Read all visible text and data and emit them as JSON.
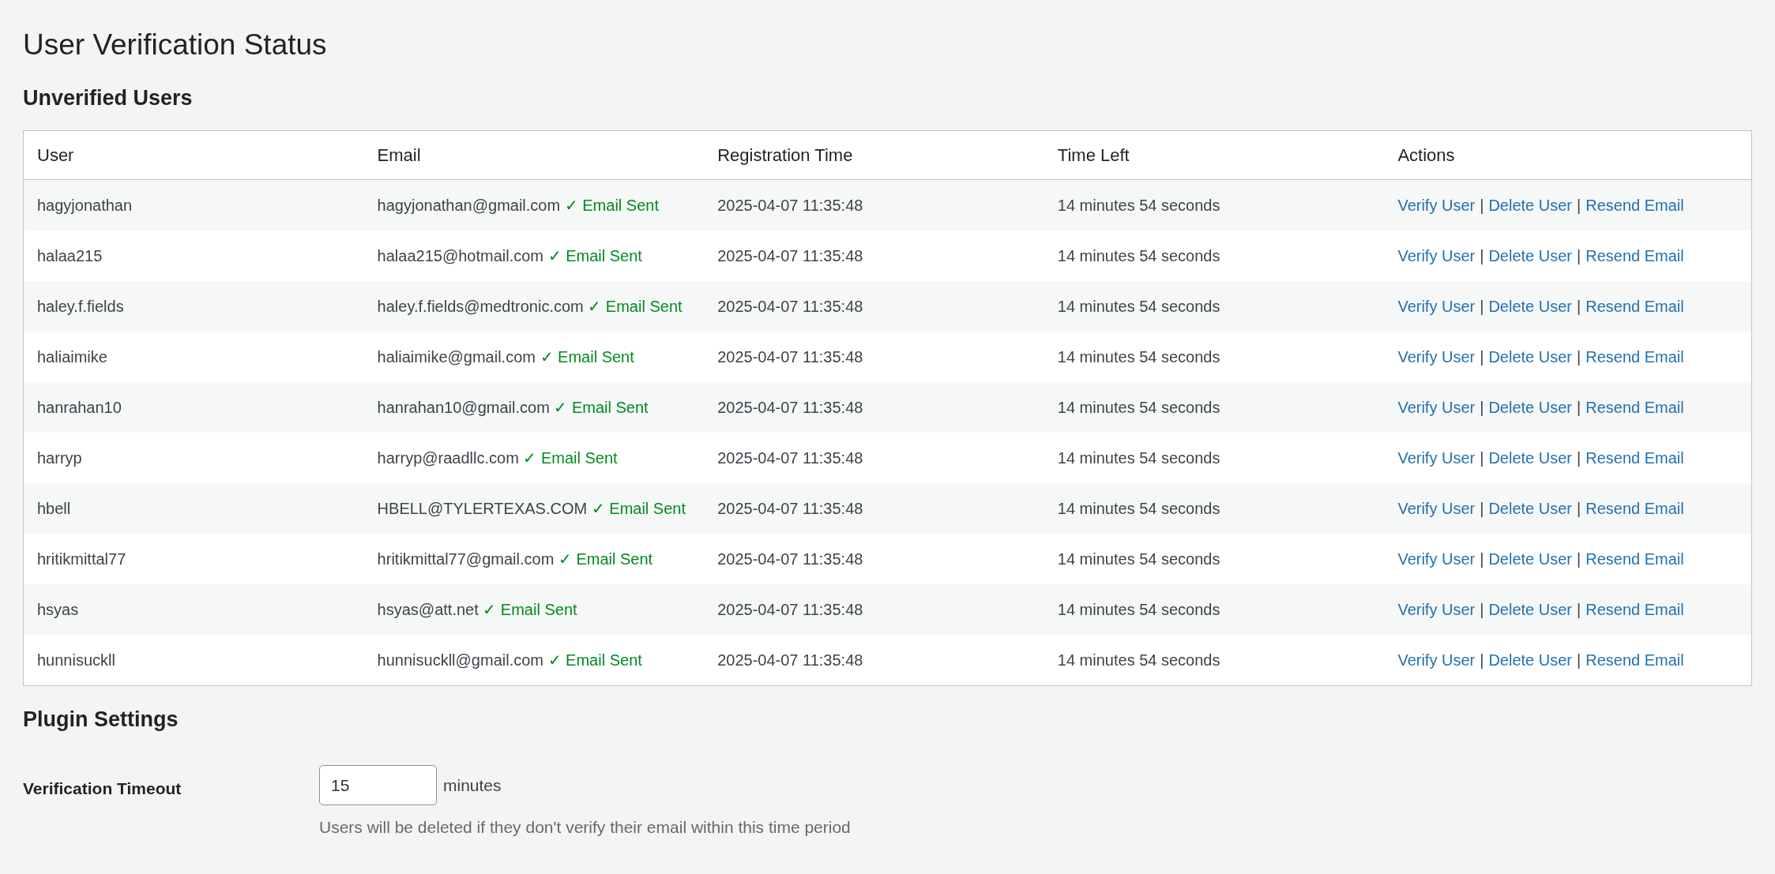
{
  "page_title": "User Verification Status",
  "unverified_section": {
    "heading": "Unverified Users"
  },
  "table": {
    "columns": [
      "User",
      "Email",
      "Registration Time",
      "Time Left",
      "Actions"
    ],
    "rows": [
      {
        "user": "hagyjonathan",
        "email": "hagyjonathan@gmail.com",
        "status": "✓ Email Sent",
        "registration": "2025-04-07 11:35:48",
        "time_left": "14 minutes 54 seconds",
        "actions": [
          {
            "kind": "link",
            "label": "Verify User"
          },
          {
            "kind": "separator",
            "label": "|"
          },
          {
            "kind": "link",
            "label": "Delete User"
          },
          {
            "kind": "separator",
            "label": "|"
          },
          {
            "kind": "link",
            "label": "Resend Email"
          }
        ]
      },
      {
        "user": "halaa215",
        "email": "halaa215@hotmail.com",
        "status": "✓ Email Sent",
        "registration": "2025-04-07 11:35:48",
        "time_left": "14 minutes 54 seconds",
        "actions": [
          {
            "kind": "link",
            "label": "Verify User"
          },
          {
            "kind": "separator",
            "label": "|"
          },
          {
            "kind": "link",
            "label": "Delete User"
          },
          {
            "kind": "separator",
            "label": "|"
          },
          {
            "kind": "link",
            "label": "Resend Email"
          }
        ]
      },
      {
        "user": "haley.f.fields",
        "email": "haley.f.fields@medtronic.com",
        "status": "✓ Email Sent",
        "registration": "2025-04-07 11:35:48",
        "time_left": "14 minutes 54 seconds",
        "actions": [
          {
            "kind": "link",
            "label": "Verify User"
          },
          {
            "kind": "separator",
            "label": "|"
          },
          {
            "kind": "link",
            "label": "Delete User"
          },
          {
            "kind": "separator",
            "label": "|"
          },
          {
            "kind": "link",
            "label": "Resend Email"
          }
        ]
      },
      {
        "user": "haliaimike",
        "email": "haliaimike@gmail.com",
        "status": "✓ Email Sent",
        "registration": "2025-04-07 11:35:48",
        "time_left": "14 minutes 54 seconds",
        "actions": [
          {
            "kind": "link",
            "label": "Verify User"
          },
          {
            "kind": "separator",
            "label": "|"
          },
          {
            "kind": "link",
            "label": "Delete User"
          },
          {
            "kind": "separator",
            "label": "|"
          },
          {
            "kind": "link",
            "label": "Resend Email"
          }
        ]
      },
      {
        "user": "hanrahan10",
        "email": "hanrahan10@gmail.com",
        "status": "✓ Email Sent",
        "registration": "2025-04-07 11:35:48",
        "time_left": "14 minutes 54 seconds",
        "actions": [
          {
            "kind": "link",
            "label": "Verify User"
          },
          {
            "kind": "separator",
            "label": "|"
          },
          {
            "kind": "link",
            "label": "Delete User"
          },
          {
            "kind": "separator",
            "label": "|"
          },
          {
            "kind": "link",
            "label": "Resend Email"
          }
        ]
      },
      {
        "user": "harryp",
        "email": "harryp@raadllc.com",
        "status": "✓ Email Sent",
        "registration": "2025-04-07 11:35:48",
        "time_left": "14 minutes 54 seconds",
        "actions": [
          {
            "kind": "link",
            "label": "Verify User"
          },
          {
            "kind": "separator",
            "label": "|"
          },
          {
            "kind": "link",
            "label": "Delete User"
          },
          {
            "kind": "separator",
            "label": "|"
          },
          {
            "kind": "link",
            "label": "Resend Email"
          }
        ]
      },
      {
        "user": "hbell",
        "email": "HBELL@TYLERTEXAS.COM",
        "status": "✓ Email Sent",
        "registration": "2025-04-07 11:35:48",
        "time_left": "14 minutes 54 seconds",
        "actions": [
          {
            "kind": "link",
            "label": "Verify User"
          },
          {
            "kind": "separator",
            "label": "|"
          },
          {
            "kind": "link",
            "label": "Delete User"
          },
          {
            "kind": "separator",
            "label": "|"
          },
          {
            "kind": "link",
            "label": "Resend Email"
          }
        ]
      },
      {
        "user": "hritikmittal77",
        "email": "hritikmittal77@gmail.com",
        "status": "✓ Email Sent",
        "registration": "2025-04-07 11:35:48",
        "time_left": "14 minutes 54 seconds",
        "actions": [
          {
            "kind": "link",
            "label": "Verify User"
          },
          {
            "kind": "separator",
            "label": "|"
          },
          {
            "kind": "link",
            "label": "Delete User"
          },
          {
            "kind": "separator",
            "label": "|"
          },
          {
            "kind": "link",
            "label": "Resend Email"
          }
        ]
      },
      {
        "user": "hsyas",
        "email": "hsyas@att.net",
        "status": "✓ Email Sent",
        "registration": "2025-04-07 11:35:48",
        "time_left": "14 minutes 54 seconds",
        "actions": [
          {
            "kind": "link",
            "label": "Verify User"
          },
          {
            "kind": "separator",
            "label": "|"
          },
          {
            "kind": "link",
            "label": "Delete User"
          },
          {
            "kind": "separator",
            "label": "|"
          },
          {
            "kind": "link",
            "label": "Resend Email"
          }
        ]
      },
      {
        "user": "hunnisuckll",
        "email": "hunnisuckll@gmail.com",
        "status": "✓ Email Sent",
        "registration": "2025-04-07 11:35:48",
        "time_left": "14 minutes 54 seconds",
        "actions": [
          {
            "kind": "link",
            "label": "Verify User"
          },
          {
            "kind": "separator",
            "label": "|"
          },
          {
            "kind": "link",
            "label": "Delete User"
          },
          {
            "kind": "separator",
            "label": "|"
          },
          {
            "kind": "link",
            "label": "Resend Email"
          }
        ]
      }
    ]
  },
  "settings": {
    "heading": "Plugin Settings",
    "fields": [
      {
        "label": "Verification Timeout",
        "value": "15",
        "unit": "minutes",
        "description": "Users will be deleted if they don't verify their email within this time period"
      }
    ]
  }
}
